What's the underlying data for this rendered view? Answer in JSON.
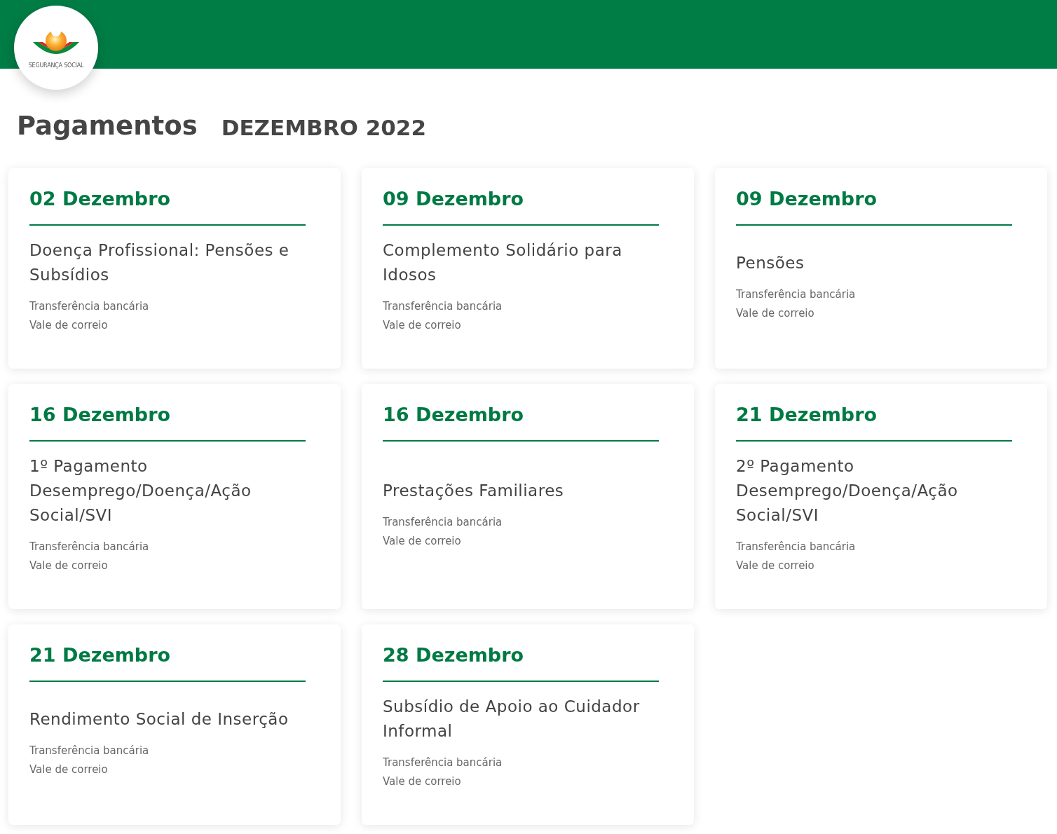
{
  "header": {
    "logo_text": "SEGURANÇA SOCIAL"
  },
  "title": "Pagamentos",
  "month": "DEZEMBRO 2022",
  "cards": [
    {
      "date": "02 Dezembro",
      "subject": "Doença Profissional: Pensões e Subsídios",
      "methods": [
        "Transferência bancária",
        "Vale de correio"
      ]
    },
    {
      "date": "09 Dezembro",
      "subject": "Complemento Solidário para Idosos",
      "methods": [
        "Transferência bancária",
        "Vale de correio"
      ]
    },
    {
      "date": "09 Dezembro",
      "subject": "Pensões",
      "methods": [
        "Transferência bancária",
        "Vale de correio"
      ]
    },
    {
      "date": "16 Dezembro",
      "subject": "1º Pagamento Desemprego/Doença/Ação Social/SVI",
      "methods": [
        "Transferência bancária",
        "Vale de correio"
      ]
    },
    {
      "date": "16 Dezembro",
      "subject": "Prestações Familiares",
      "methods": [
        "Transferência bancária",
        "Vale de correio"
      ]
    },
    {
      "date": "21 Dezembro",
      "subject": "2º Pagamento Desemprego/Doença/Ação Social/SVI",
      "methods": [
        "Transferência bancária",
        "Vale de correio"
      ]
    },
    {
      "date": "21 Dezembro",
      "subject": "Rendimento Social de Inserção",
      "methods": [
        "Transferência bancária",
        "Vale de correio"
      ]
    },
    {
      "date": "28 Dezembro",
      "subject": "Subsídio de Apoio ao Cuidador Informal",
      "methods": [
        "Transferência bancária",
        "Vale de correio"
      ]
    }
  ]
}
